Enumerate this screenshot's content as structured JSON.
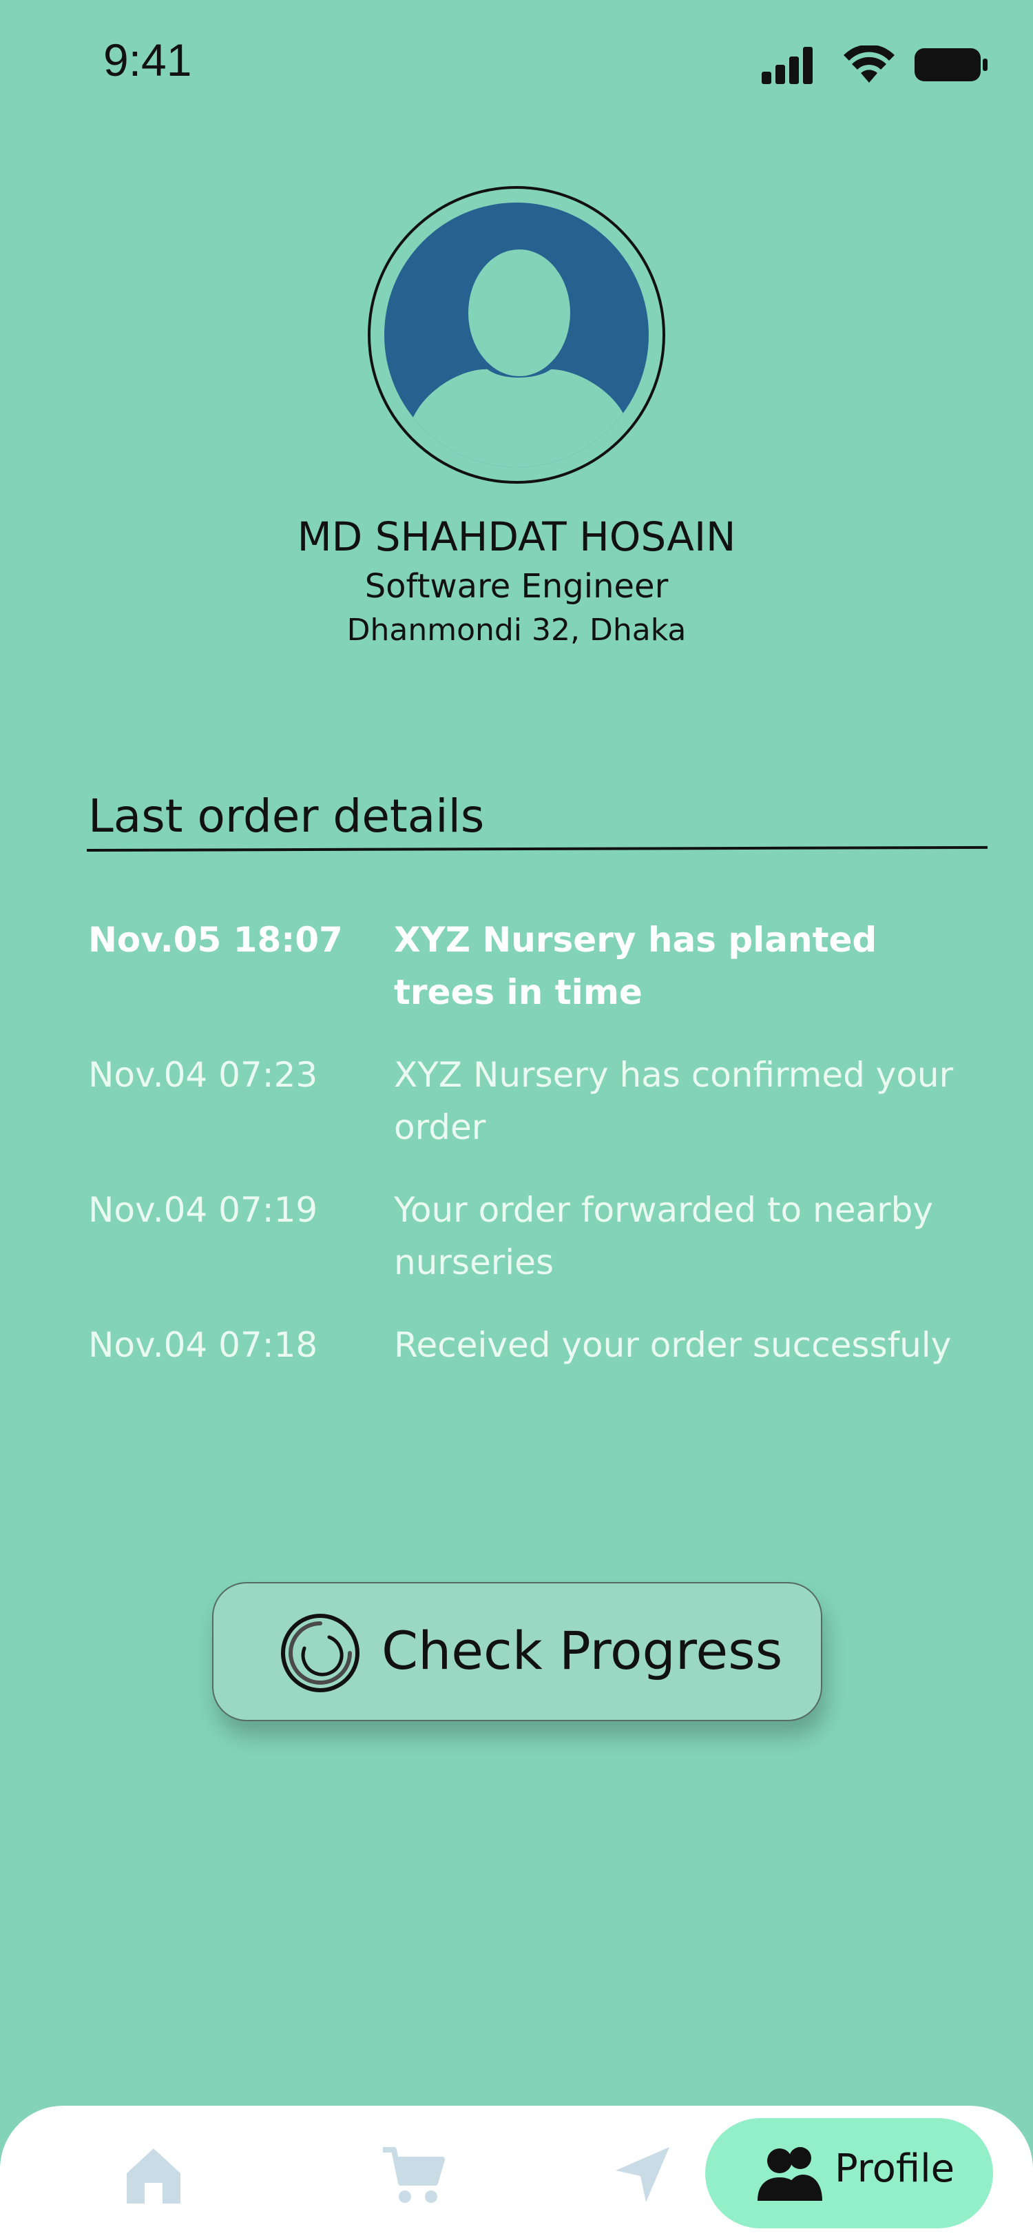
{
  "status_bar": {
    "time": "9:41",
    "icons": [
      "cellular-signal-icon",
      "wifi-icon",
      "battery-icon"
    ]
  },
  "profile": {
    "avatar_icon": "user-avatar-icon",
    "name": "MD SHAHDAT HOSAIN",
    "role": "Software Engineer",
    "location": "Dhanmondi 32, Dhaka"
  },
  "orders": {
    "title": "Last order details",
    "items": [
      {
        "time": "Nov.05 18:07",
        "description": "XYZ Nursery has planted trees in time",
        "highlighted": true
      },
      {
        "time": "Nov.04 07:23",
        "description": "XYZ Nursery has confirmed your order",
        "highlighted": false
      },
      {
        "time": "Nov.04 07:19",
        "description": "Your order forwarded to nearby nurseries",
        "highlighted": false
      },
      {
        "time": "Nov.04 07:18",
        "description": "Received your order successfuly",
        "highlighted": false
      }
    ]
  },
  "progress_button": {
    "label": "Check Progress",
    "icon": "progress-ring-icon"
  },
  "bottom_nav": {
    "items": [
      {
        "icon": "home-icon",
        "active": false
      },
      {
        "icon": "cart-icon",
        "active": false
      },
      {
        "icon": "send-icon",
        "active": false
      },
      {
        "icon": "users-icon",
        "label": "Profile",
        "active": true
      }
    ]
  },
  "colors": {
    "background": "#82d3b8",
    "avatar_fill": "#266190",
    "nav_active": "#93efc7",
    "nav_inactive_icon": "#c9dbe5",
    "button_fill": "#9ad8c3"
  }
}
